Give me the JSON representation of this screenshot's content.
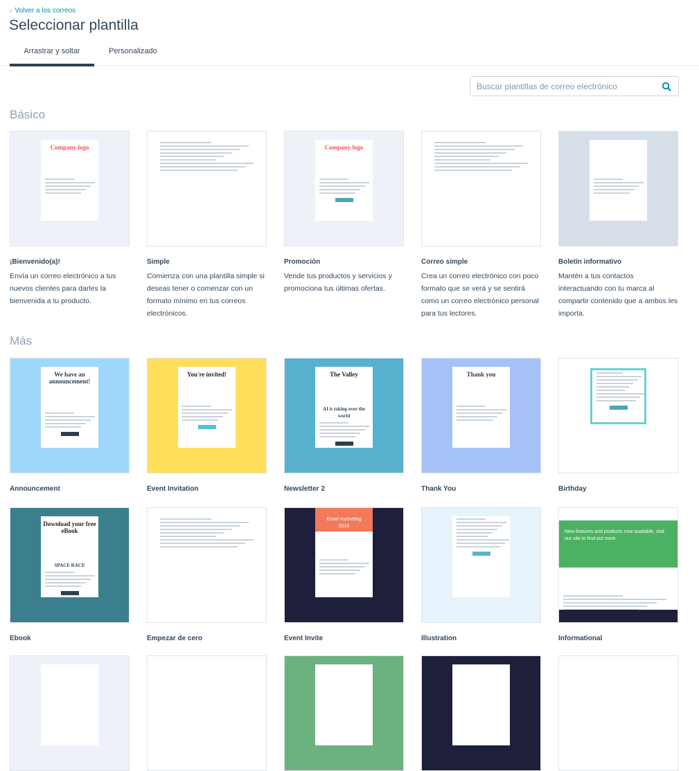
{
  "header": {
    "back_label": "Volver a los correos",
    "title": "Seleccionar plantilla"
  },
  "tabs": [
    {
      "label": "Arrastrar y soltar",
      "active": true
    },
    {
      "label": "Personalizado",
      "active": false
    }
  ],
  "search": {
    "placeholder": "Buscar plantillas de correo electrónico",
    "icon": "search-icon",
    "accent": "#0091ae"
  },
  "sections": [
    {
      "title": "Básico",
      "templates": [
        {
          "name": "¡Bienvenido(a)!",
          "description": "Envía un correo electrónico a tus nuevos clientes para darles la bienvenida a tu producto.",
          "thumb": {
            "bg": "#eef2f8",
            "heading": "Company logo",
            "heading_color": "#f2545b",
            "panel": "#fff"
          }
        },
        {
          "name": "Simple",
          "description": "Comienza con una plantilla simple si deseas tener o comenzar con un formato mínimo en tus correos electrónicos.",
          "thumb": {
            "bg": "#ffffff",
            "heading": "",
            "panel": "#fff"
          }
        },
        {
          "name": "Promoción",
          "description": "Vende tus productos y servicios y promociona tus últimas ofertas.",
          "thumb": {
            "bg": "#eef2f8",
            "heading": "Company logo",
            "heading_color": "#f2545b",
            "panel": "#fff",
            "button": "#4fa4b8"
          }
        },
        {
          "name": "Correo simple",
          "description": "Crea un correo electrónico con poco formato que se verá y se sentirá como un correo electrónico personal para tus lectores.",
          "thumb": {
            "bg": "#ffffff",
            "heading": "",
            "panel": "#fff"
          }
        },
        {
          "name": "Boletín informativo",
          "description": "Mantén a tus contactos interactuando con tu marca al compartir contenido que a ambos les importa.",
          "thumb": {
            "bg": "#d5dee9",
            "heading": "Company logo",
            "heading_color": "#ffffff",
            "panel": "#fff"
          }
        }
      ]
    },
    {
      "title": "Más",
      "templates": [
        {
          "name": "Announcement",
          "thumb": {
            "bg": "#9fd8fb",
            "heading": "We have an announcement!",
            "heading_color": "#2d3e50",
            "panel": "#fff",
            "button": "#2d3e50"
          }
        },
        {
          "name": "Event Invitation",
          "thumb": {
            "bg": "#ffde5b",
            "heading": "You're invited!",
            "heading_color": "#222",
            "panel": "#fff",
            "button": "#4fc3de"
          }
        },
        {
          "name": "Newsletter 2",
          "thumb": {
            "bg": "#57b1ce",
            "heading": "The Valley",
            "heading_color": "#222",
            "panel": "#fff",
            "subheading": "AI is taking over the world",
            "button": "#2d3e50"
          }
        },
        {
          "name": "Thank You",
          "thumb": {
            "bg": "#a4c2f5",
            "heading": "Thank you",
            "heading_color": "#2d3e50",
            "panel": "#fff"
          }
        },
        {
          "name": "Birthday",
          "thumb": {
            "bg": "#ffffff",
            "heading": "",
            "panel": "#fff",
            "button": "#4fa4b8",
            "border": "#6ad0d6"
          }
        },
        {
          "name": "Ebook",
          "thumb": {
            "bg": "#3b7f8f",
            "heading": "Download your free eBook",
            "heading_color": "#222",
            "panel": "#fff",
            "subheading": "SPACE RACE",
            "button": "#2d3e50"
          }
        },
        {
          "name": "Empezar de cero",
          "thumb": {
            "bg": "#ffffff",
            "heading": "",
            "panel": "#fff"
          }
        },
        {
          "name": "Event Invite",
          "thumb": {
            "bg": "#1e1f3b",
            "heading": "Email marketing 2018",
            "heading_color": "#ffffff",
            "header_bg": "#f2795b",
            "panel": "#fff"
          }
        },
        {
          "name": "Illustration",
          "thumb": {
            "bg": "#e8f4fb",
            "heading": "",
            "panel": "#fff",
            "button": "#5fb3c9",
            "leaves": "#3a9a94"
          }
        },
        {
          "name": "Informational",
          "thumb": {
            "bg": "#ffffff",
            "heading": "New features and products now available, visit our site to find out more",
            "heading_color": "#ffffff",
            "header_bg": "#4cb162",
            "panel": "#fff",
            "footer": "#1e1f3b"
          }
        },
        {
          "name": "",
          "thumb": {
            "bg": "#eef2f8"
          }
        },
        {
          "name": "",
          "thumb": {
            "bg": "#ffffff"
          }
        },
        {
          "name": "",
          "thumb": {
            "bg": "#6bb27e"
          }
        },
        {
          "name": "",
          "thumb": {
            "bg": "#1e1f3b"
          }
        },
        {
          "name": "",
          "thumb": {
            "bg": "#ffffff"
          }
        }
      ]
    }
  ]
}
